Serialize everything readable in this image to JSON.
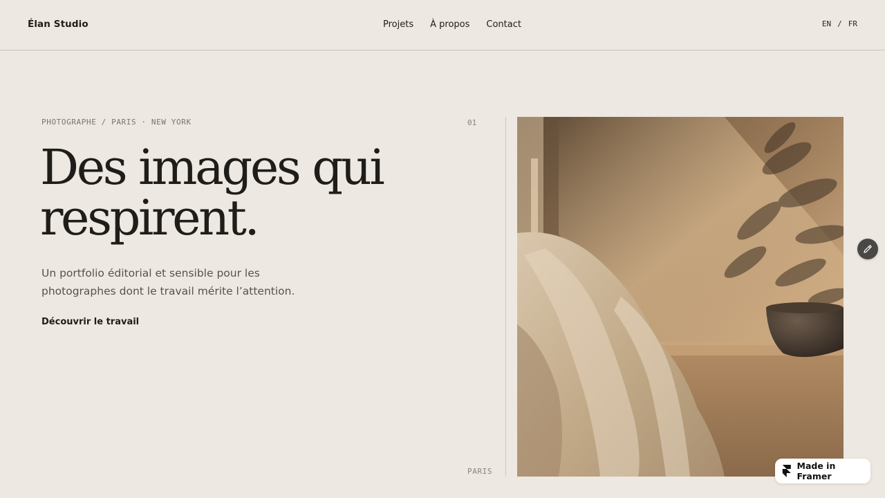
{
  "header": {
    "brand": "Élan Studio",
    "nav": [
      "Projets",
      "À propos",
      "Contact"
    ],
    "lang": {
      "en": "EN",
      "separator": "/",
      "fr": "FR"
    }
  },
  "hero": {
    "eyebrow": "PHOTOGRAPHE / PARIS · NEW YORK",
    "headline_line1": "Des images qui",
    "headline_line2": "respirent.",
    "lede_line1": "Un portfolio éditorial et sensible pour les",
    "lede_line2": "photographes dont le travail mérite l’attention.",
    "cta": "Découvrir le travail"
  },
  "gallery": {
    "index": "01",
    "location": "PARIS"
  },
  "badge": {
    "label": "Made in Framer",
    "icon": "framer-logo-icon"
  },
  "edit": {
    "icon": "pencil-icon"
  },
  "colors": {
    "background": "#ede8e1",
    "text": "#1f1d1a",
    "muted": "#7a746c",
    "divider": "#c9c3ba"
  }
}
